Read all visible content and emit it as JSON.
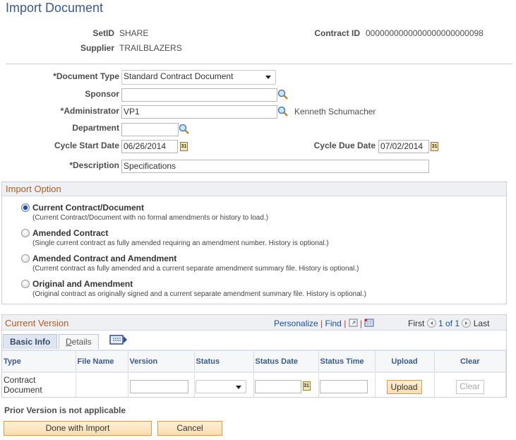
{
  "page": {
    "title": "Import Document"
  },
  "header": {
    "setid_label": "SetID",
    "setid_value": "SHARE",
    "supplier_label": "Supplier",
    "supplier_value": "TRAILBLAZERS",
    "contract_id_label": "Contract ID",
    "contract_id_value": "0000000000000000000000098"
  },
  "form": {
    "document_type": {
      "label": "*Document Type",
      "value": "Standard Contract Document"
    },
    "sponsor": {
      "label": "Sponsor",
      "value": ""
    },
    "administrator": {
      "label": "*Administrator",
      "value": "VP1",
      "name": "Kenneth Schumacher"
    },
    "department": {
      "label": "Department",
      "value": ""
    },
    "cycle_start_date": {
      "label": "Cycle Start Date",
      "value": "06/26/2014"
    },
    "cycle_due_date": {
      "label": "Cycle Due Date",
      "value": "07/02/2014"
    },
    "description": {
      "label": "*Description",
      "value": "Specifications"
    }
  },
  "import_option": {
    "title": "Import Option",
    "options": [
      {
        "label": "Current Contract/Document",
        "desc": "(Current Contract/Document with no formal amendments or history to load.)",
        "checked": true
      },
      {
        "label": "Amended Contract",
        "desc": "(Single current contract as fully amended requiring an amendment number. History is optional.)",
        "checked": false
      },
      {
        "label": "Amended Contract and Amendment",
        "desc": "(Current contract as fully amended and a current separate amendment summary file. History is optional.)",
        "checked": false
      },
      {
        "label": "Original and Amendment",
        "desc": "(Original contract as originally signed and a current separate amendment summary file. History is optional.)",
        "checked": false
      }
    ]
  },
  "current_version": {
    "title": "Current Version",
    "personalize": "Personalize",
    "find": "Find",
    "sep": "|",
    "first": "First",
    "count": "1 of 1",
    "last": "Last",
    "tabs": [
      {
        "label": "Basic Info",
        "active": true
      },
      {
        "label": "Details",
        "active": false
      }
    ],
    "columns": [
      "Type",
      "File Name",
      "Version",
      "Status",
      "Status Date",
      "Status Time",
      "Upload",
      "Clear"
    ],
    "rows": [
      {
        "type_line1": "Contract",
        "type_line2": "Document",
        "file_name": "",
        "version": "",
        "status": "",
        "status_date": "",
        "status_time": "",
        "upload": "Upload",
        "clear": "Clear"
      }
    ]
  },
  "footer": {
    "prior_version_note": "Prior Version is not applicable",
    "done_button": "Done with Import",
    "cancel_button": "Cancel"
  }
}
